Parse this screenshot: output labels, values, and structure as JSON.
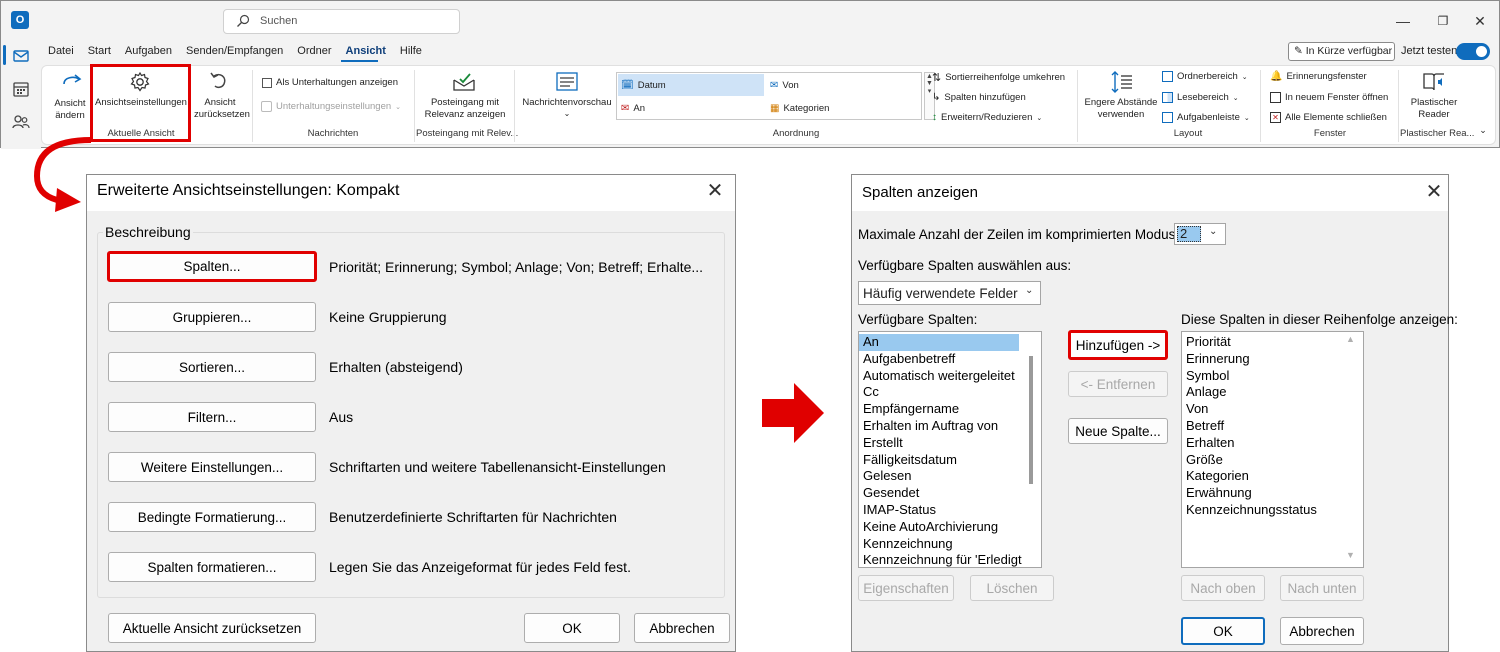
{
  "outlook": {
    "search_placeholder": "Suchen",
    "menu": [
      "Datei",
      "Start",
      "Aufgaben",
      "Senden/Empfangen",
      "Ordner",
      "Ansicht",
      "Hilfe"
    ],
    "active_menu": "Ansicht",
    "coming_soon": "In Kürze verfügbar",
    "try_now": "Jetzt testen",
    "ribbon": {
      "change_view": "Ansicht ändern",
      "view_settings": "Ansichtseinstellungen",
      "reset_view": "Ansicht zurücksetzen",
      "current_view_group": "Aktuelle Ansicht",
      "show_as_conversations": "Als Unterhaltungen anzeigen",
      "conversation_settings": "Unterhaltungseinstellungen",
      "messages_group": "Nachrichten",
      "focused_inbox": "Posteingang mit Relevanz anzeigen",
      "focused_inbox_group": "Posteingang mit Relev...",
      "message_preview": "Nachrichtenvorschau",
      "arrangement": [
        "Datum",
        "Von",
        "An",
        "Kategorien"
      ],
      "reverse_sort": "Sortierreihenfolge umkehren",
      "add_columns": "Spalten hinzufügen",
      "expand_collapse": "Erweitern/Reduzieren",
      "arrangement_group": "Anordnung",
      "compact_spacing": "Engere Abstände verwenden",
      "folder_pane": "Ordnerbereich",
      "reading_pane": "Lesebereich",
      "todo_bar": "Aufgabenleiste",
      "layout_group": "Layout",
      "reminders_window": "Erinnerungsfenster",
      "open_new_window": "In neuem Fenster öffnen",
      "close_all": "Alle Elemente schließen",
      "window_group": "Fenster",
      "immersive_reader": "Plastischer Reader",
      "immersive_group": "Plastischer Rea..."
    }
  },
  "advanced_dialog": {
    "title": "Erweiterte Ansichtseinstellungen: Kompakt",
    "group_label": "Beschreibung",
    "rows": [
      {
        "button": "Spalten...",
        "desc": "Priorität; Erinnerung; Symbol; Anlage; Von; Betreff; Erhalte..."
      },
      {
        "button": "Gruppieren...",
        "desc": "Keine Gruppierung"
      },
      {
        "button": "Sortieren...",
        "desc": "Erhalten (absteigend)"
      },
      {
        "button": "Filtern...",
        "desc": "Aus"
      },
      {
        "button": "Weitere Einstellungen...",
        "desc": "Schriftarten und weitere Tabellenansicht-Einstellungen"
      },
      {
        "button": "Bedingte Formatierung...",
        "desc": "Benutzerdefinierte Schriftarten für Nachrichten"
      },
      {
        "button": "Spalten formatieren...",
        "desc": "Legen Sie das Anzeigeformat für jedes Feld fest."
      }
    ],
    "reset_button": "Aktuelle Ansicht zurücksetzen",
    "ok": "OK",
    "cancel": "Abbrechen"
  },
  "columns_dialog": {
    "title": "Spalten anzeigen",
    "max_rows_label": "Maximale Anzahl der Zeilen im komprimierten Modus:",
    "max_rows_value": "2",
    "select_from_label": "Verfügbare Spalten auswählen aus:",
    "select_from_value": "Häufig verwendete Felder",
    "available_label": "Verfügbare Spalten:",
    "available": [
      "An",
      "Aufgabenbetreff",
      "Automatisch weitergeleitet",
      "Cc",
      "Empfängername",
      "Erhalten im Auftrag von",
      "Erstellt",
      "Fälligkeitsdatum",
      "Gelesen",
      "Gesendet",
      "IMAP-Status",
      "Keine AutoArchivierung",
      "Kennzeichnung",
      "Kennzeichnung für 'Erledigt"
    ],
    "selected_available": "An",
    "shown_label": "Diese Spalten in dieser Reihenfolge anzeigen:",
    "shown": [
      "Priorität",
      "Erinnerung",
      "Symbol",
      "Anlage",
      "Von",
      "Betreff",
      "Erhalten",
      "Größe",
      "Kategorien",
      "Erwähnung",
      "Kennzeichnungsstatus"
    ],
    "add": "Hinzufügen ->",
    "remove": "<- Entfernen",
    "new_column": "Neue Spalte...",
    "properties": "Eigenschaften",
    "delete": "Löschen",
    "move_up": "Nach oben",
    "move_down": "Nach unten",
    "ok": "OK",
    "cancel": "Abbrechen"
  },
  "colors": {
    "highlight": "#e00000",
    "accent": "#0f6cbd",
    "selection": "#99c9ef"
  }
}
